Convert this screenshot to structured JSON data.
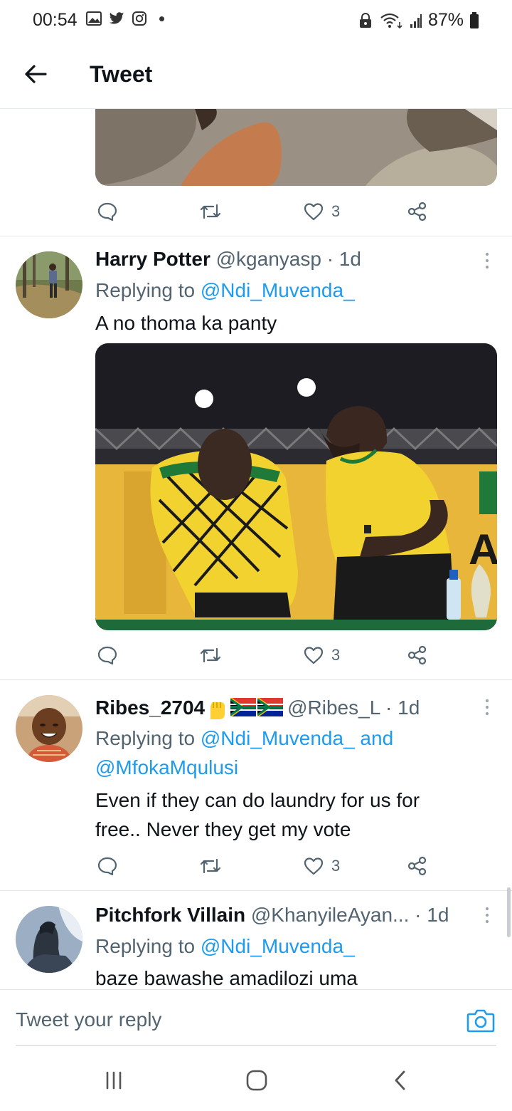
{
  "status_bar": {
    "time": "00:54",
    "battery": "87%",
    "left_icons": [
      "gallery-icon",
      "twitter-icon",
      "instagram-icon"
    ],
    "right_icons": [
      "lock-icon",
      "wifi-icon",
      "signal-icon",
      "battery-icon"
    ]
  },
  "header": {
    "title": "Tweet"
  },
  "previous_tweet": {
    "likes": "3"
  },
  "tweets": [
    {
      "name": "Harry Potter",
      "handle": "@kganyasp",
      "time": "· 1d",
      "replying_prefix": "Replying to ",
      "replying_to": "@Ndi_Muvenda_",
      "text": "A no thoma ka panty",
      "likes": "3"
    },
    {
      "name": "Ribes_2704",
      "name_emoji": "✊🇿🇦🇿🇦",
      "handle": "@Ribes_L",
      "time": "· 1d",
      "replying_prefix": "Replying to ",
      "replying_to": "@Ndi_Muvenda_",
      "replying_and": " and",
      "replying_to_2": "@MfokaMqulusi",
      "text": "Even if they can do laundry for us for free.. Never they get my vote",
      "likes": "3"
    },
    {
      "name": "Pitchfork Villain",
      "handle": "@KhanyileAyan...",
      "time": "· 1d",
      "replying_prefix": "Replying to ",
      "replying_to": "@Ndi_Muvenda_",
      "text": "baze bawashe amadilozi uma"
    }
  ],
  "reply_bar": {
    "placeholder": "Tweet your reply"
  },
  "colors": {
    "link": "#1d9bf0",
    "secondary_text": "#536471",
    "anc_yellow": "#f2d22e",
    "anc_green": "#1f7a3a"
  }
}
